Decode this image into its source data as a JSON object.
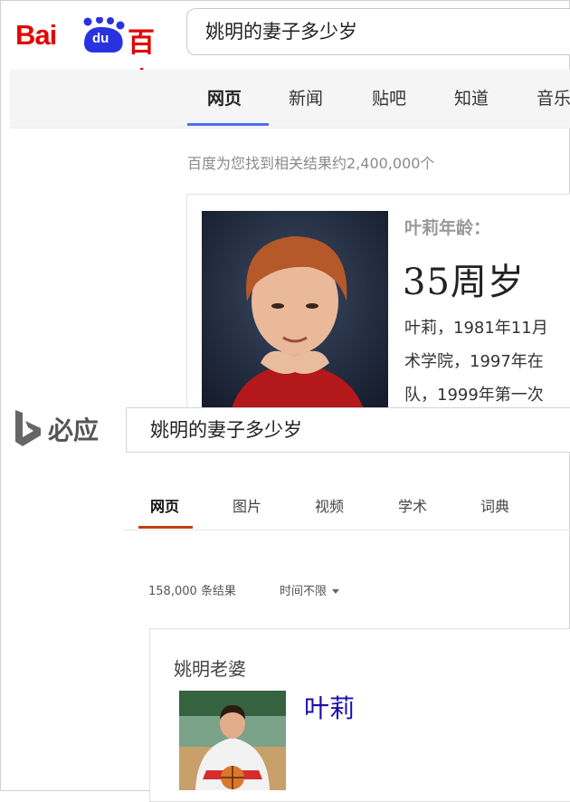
{
  "baidu": {
    "logo": {
      "bai": "Bai",
      "du": "du",
      "cn": "百度"
    },
    "search_query": "姚明的妻子多少岁",
    "tabs": [
      "网页",
      "新闻",
      "贴吧",
      "知道",
      "音乐"
    ],
    "active_tab": "网页",
    "result_count": "百度为您找到相关结果约2,400,000个",
    "card": {
      "label": "叶莉年龄：",
      "answer": "35周岁",
      "lines": [
        "叶莉，1981年11月",
        "术学院，1997年在",
        "队，1999年第一次"
      ]
    }
  },
  "bing": {
    "logo_text": "必应",
    "search_query": "姚明的妻子多少岁",
    "tabs": [
      "网页",
      "图片",
      "视频",
      "学术",
      "词典"
    ],
    "active_tab": "网页",
    "result_count": "158,000 条结果",
    "time_filter": "时间不限",
    "card": {
      "title": "姚明老婆",
      "name": "叶莉"
    }
  },
  "colors": {
    "baidu_red": "#e10601",
    "baidu_blue": "#2932e1",
    "baidu_tab_underline": "#4e6ef2",
    "bing_underline": "#c2410c",
    "link_blue": "#1a0dab"
  }
}
